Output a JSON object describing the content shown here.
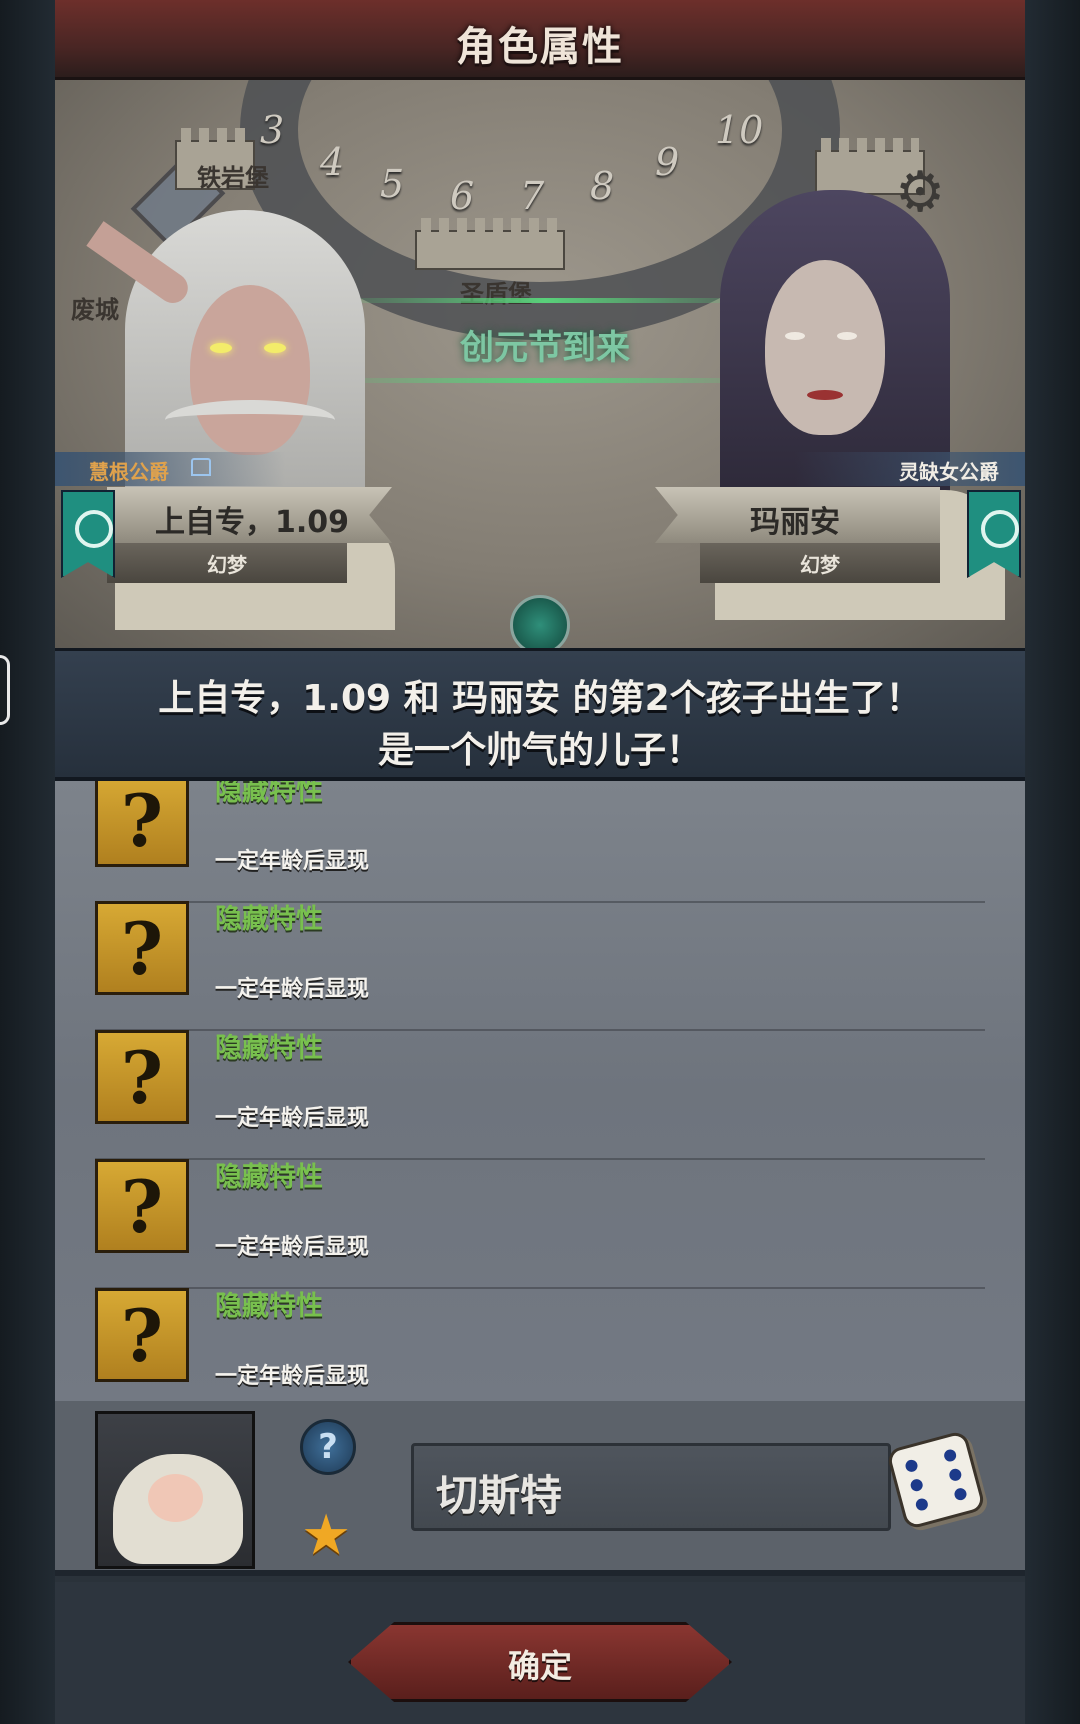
{
  "window": {
    "title": "角色属性"
  },
  "scene": {
    "map_labels": [
      "铁岩堡",
      "圣盾堡",
      "废城"
    ],
    "timeline_numbers": [
      "3",
      "4",
      "5",
      "6",
      "7",
      "8",
      "9",
      "10"
    ],
    "event_banner": "创元节到来"
  },
  "parents": {
    "left": {
      "title": "慧根公爵",
      "name": "上自专，1.09",
      "faith": "幻梦"
    },
    "right": {
      "title": "灵缺女公爵",
      "name": "玛丽安",
      "faith": "幻梦"
    }
  },
  "announcement": {
    "line1": "上自专，1.09 和 玛丽安 的第2个孩子出生了！",
    "line2": "是一个帅气的儿子！"
  },
  "traits": [
    {
      "name": "隐藏特性",
      "desc": "一定年龄后显现",
      "icon": "question-icon"
    },
    {
      "name": "隐藏特性",
      "desc": "一定年龄后显现",
      "icon": "question-icon"
    },
    {
      "name": "隐藏特性",
      "desc": "一定年龄后显现",
      "icon": "question-icon"
    },
    {
      "name": "隐藏特性",
      "desc": "一定年龄后显现",
      "icon": "question-icon"
    },
    {
      "name": "隐藏特性",
      "desc": "一定年龄后显现",
      "icon": "question-icon"
    }
  ],
  "child": {
    "name_value": "切斯特",
    "help_symbol": "?",
    "star_symbol": "★"
  },
  "footer": {
    "confirm_label": "确定"
  },
  "colors": {
    "trait_name": "#78c04e",
    "title_left": "#e0a24c",
    "confirm": "#8a3631"
  }
}
